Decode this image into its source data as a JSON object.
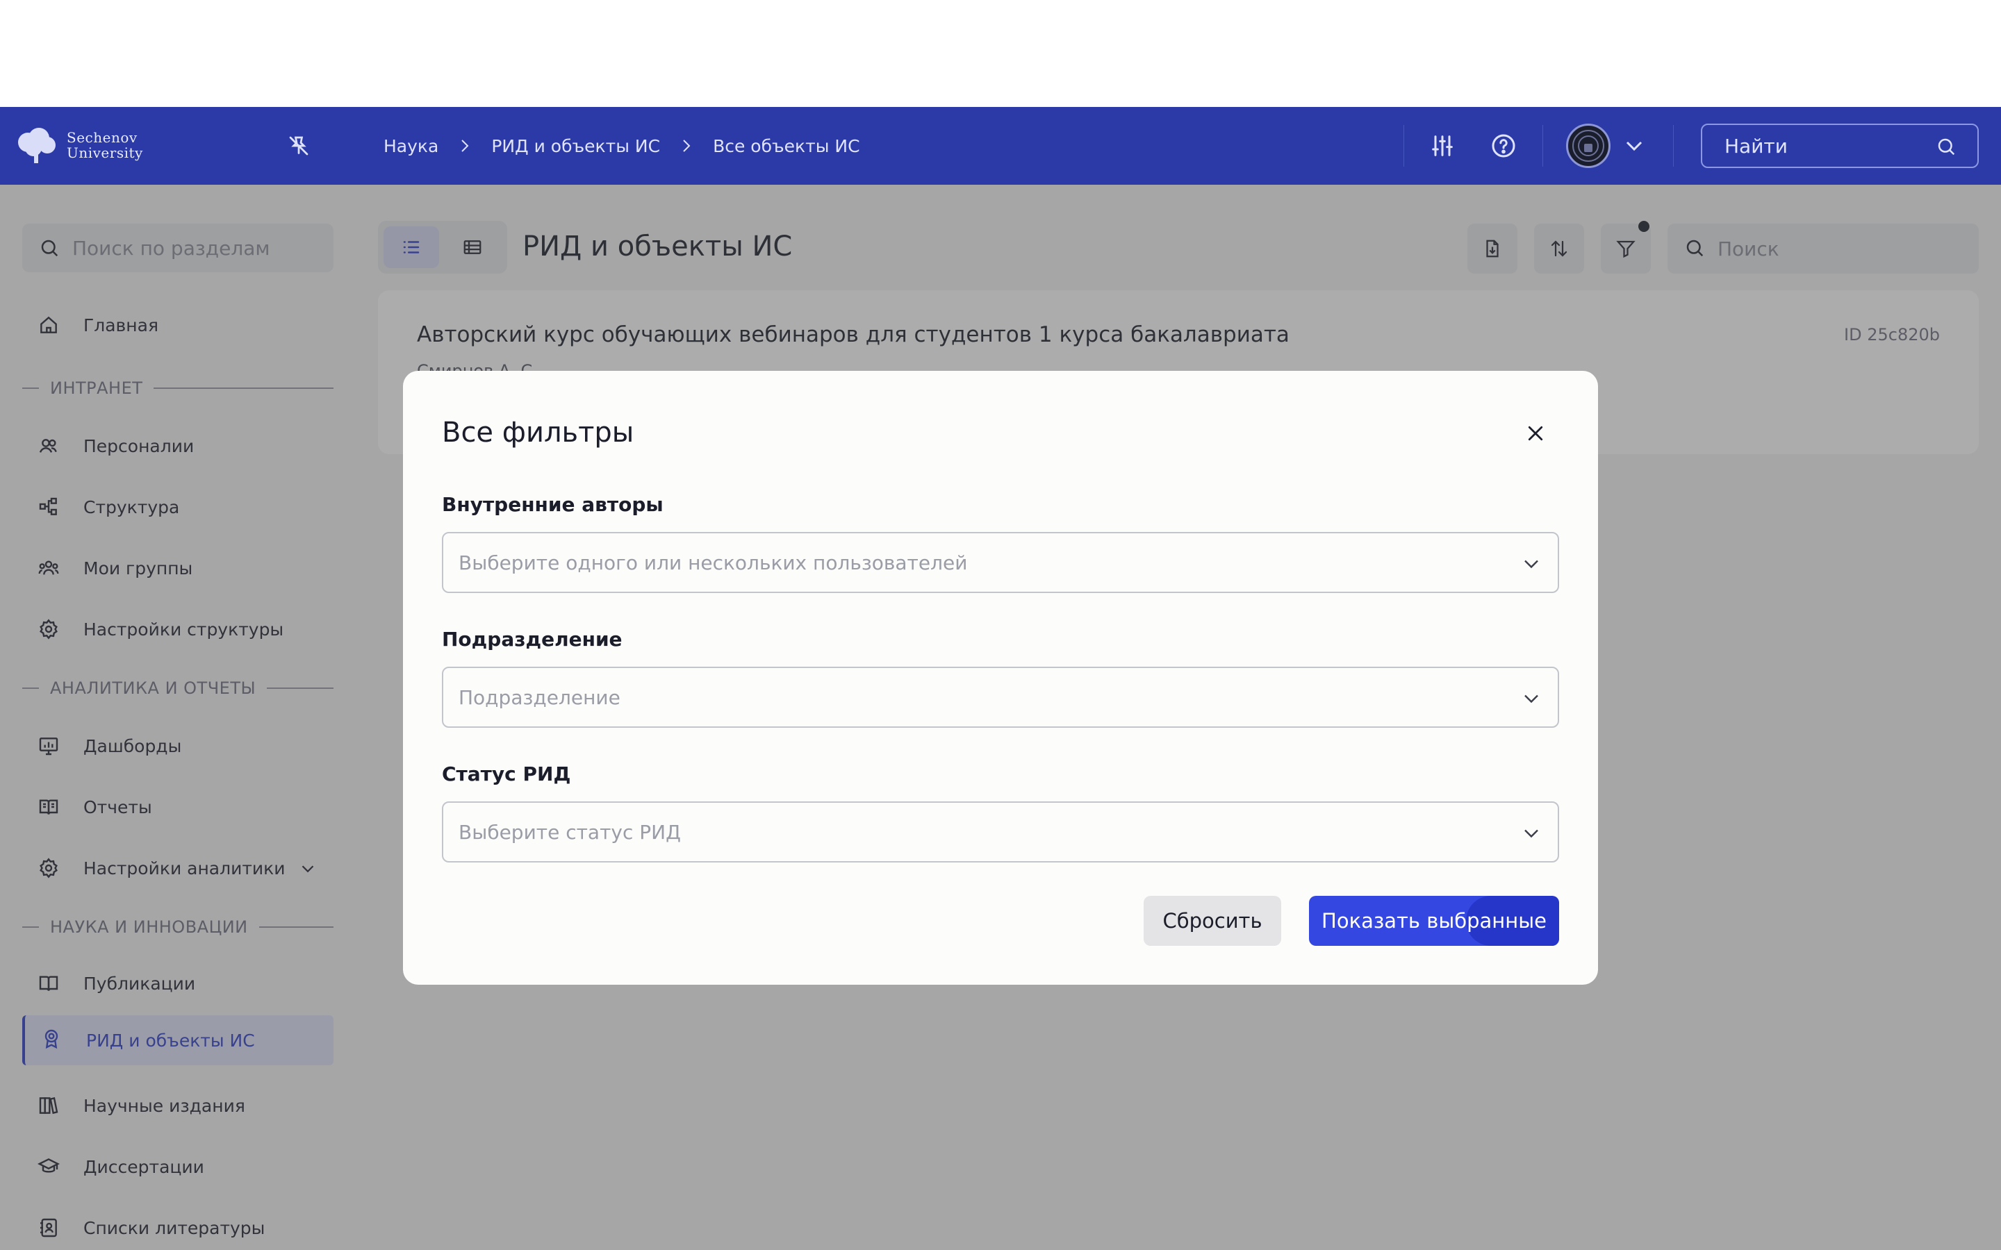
{
  "header": {
    "logo_line1": "Sechenov",
    "logo_line2": "University",
    "breadcrumb": [
      "Наука",
      "РИД и объекты ИС",
      "Все объекты ИС"
    ],
    "search_placeholder": "Найти"
  },
  "sidebar": {
    "search_placeholder": "Поиск по разделам",
    "home": "Главная",
    "sections": [
      {
        "title": "ИНТРАНЕТ",
        "items": [
          "Персоналии",
          "Структура",
          "Мои группы",
          "Настройки структуры"
        ]
      },
      {
        "title": "АНАЛИТИКА И ОТЧЕТЫ",
        "items": [
          "Дашборды",
          "Отчеты",
          "Настройки аналитики"
        ]
      },
      {
        "title": "НАУКА И ИННОВАЦИИ",
        "items": [
          "Публикации",
          "РИД и объекты ИС",
          "Научные издания",
          "Диссертации",
          "Списки литературы"
        ]
      }
    ],
    "active_item": "РИД и объекты ИС"
  },
  "main": {
    "title": "РИД и объекты ИС",
    "search_placeholder": "Поиск",
    "card": {
      "title": "Авторский курс обучающих вебинаров для студентов 1 курса бакалавриата",
      "subtitle": "Смирнов А. С.",
      "id": "ID 25c820b"
    }
  },
  "modal": {
    "title": "Все фильтры",
    "fields": [
      {
        "label": "Внутренние авторы",
        "placeholder": "Выберите одного или нескольких пользователей"
      },
      {
        "label": "Подразделение",
        "placeholder": "Подразделение"
      },
      {
        "label": "Статус РИД",
        "placeholder": "Выберите статус РИД"
      }
    ],
    "reset_label": "Сбросить",
    "apply_label": "Показать выбранные"
  },
  "colors": {
    "header_bg": "#2b3aa6",
    "accent": "#3447e0",
    "active_nav_bg": "#dfe2fb"
  }
}
